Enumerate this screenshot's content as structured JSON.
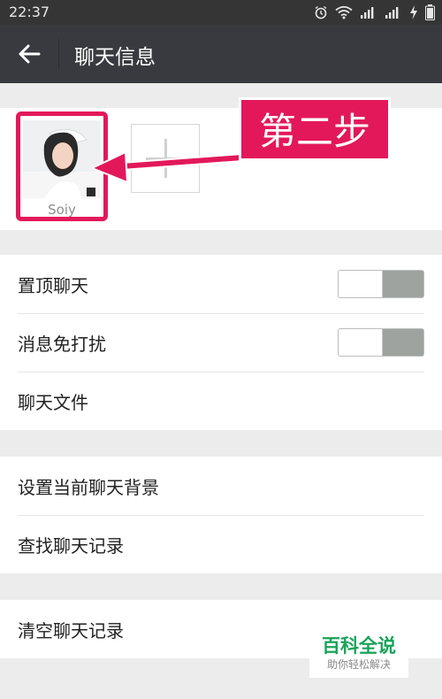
{
  "status_bar": {
    "time": "22:37",
    "icons": [
      "alarm-icon",
      "wifi-icon",
      "signal-icon",
      "signal-icon",
      "charging-icon",
      "battery-icon"
    ]
  },
  "header": {
    "title": "聊天信息",
    "back_icon": "back-arrow-icon"
  },
  "members": {
    "items": [
      {
        "name": "Soiy"
      }
    ],
    "add_icon": "plus-icon"
  },
  "annotation": {
    "label": "第二步",
    "color": "#e3185b"
  },
  "sections": [
    {
      "rows": [
        {
          "label": "置顶聊天",
          "toggle": false
        },
        {
          "label": "消息免打扰",
          "toggle": false
        },
        {
          "label": "聊天文件"
        }
      ]
    },
    {
      "rows": [
        {
          "label": "设置当前聊天背景"
        },
        {
          "label": "查找聊天记录"
        }
      ]
    },
    {
      "rows": [
        {
          "label": "清空聊天记录"
        }
      ]
    }
  ],
  "watermark": {
    "title": "百科全说",
    "subtitle": "助你轻松解决"
  },
  "colors": {
    "title_bar": "#393a3f",
    "status_bar": "#353535",
    "background": "#ececec",
    "toggle_off": "#9ea3a0"
  }
}
